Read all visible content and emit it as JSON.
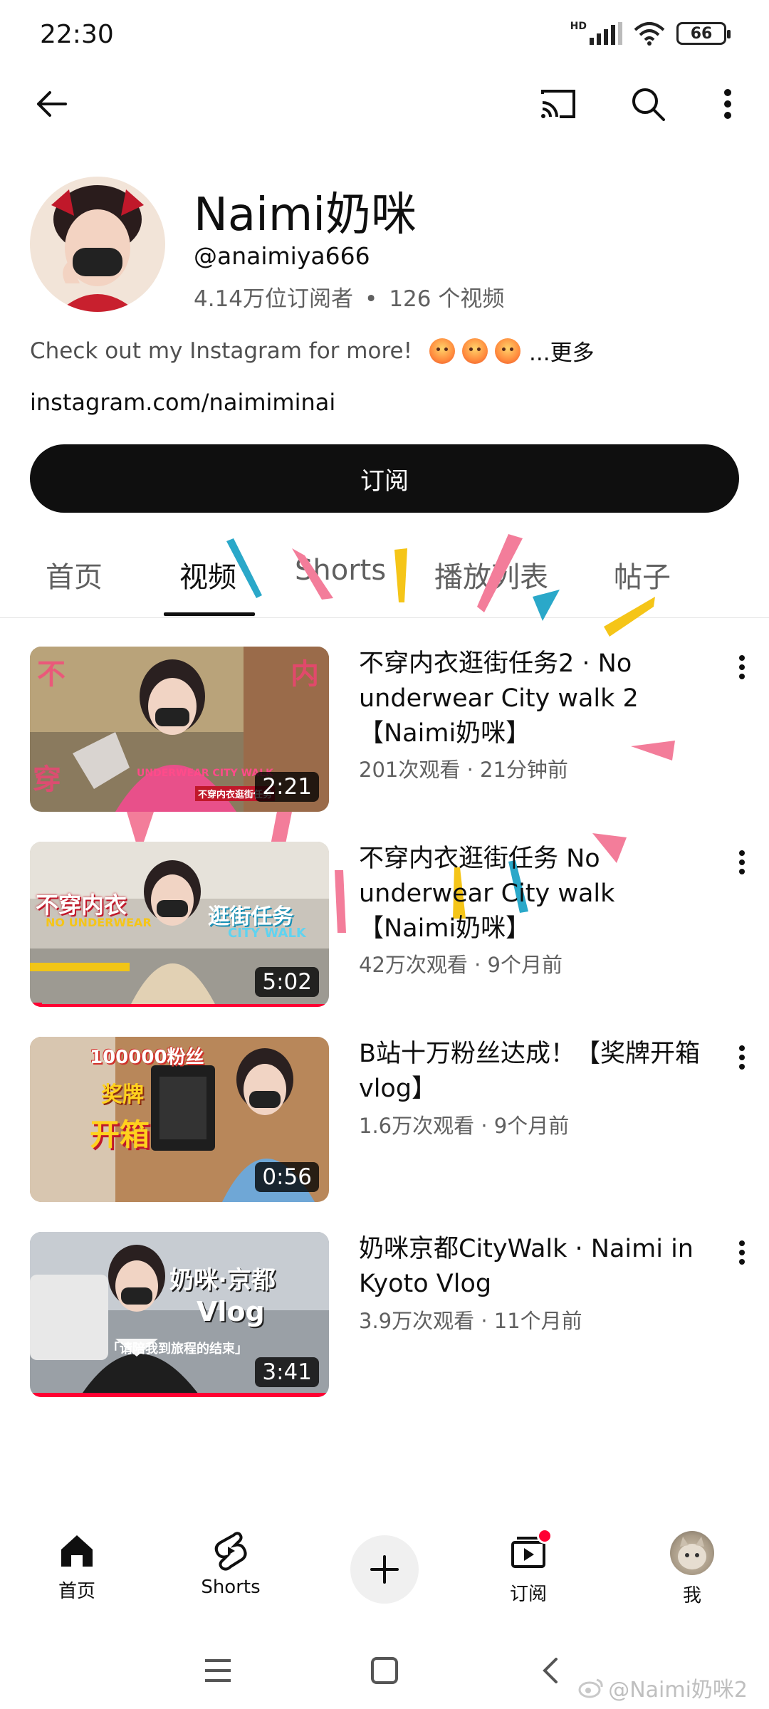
{
  "status_bar": {
    "time": "22:30",
    "battery": "66",
    "network_badge": "HD"
  },
  "top_bar": {
    "icons": [
      "back-arrow-icon",
      "cast-icon",
      "search-icon",
      "more-vert-icon"
    ]
  },
  "channel": {
    "name": "Naimi奶咪",
    "handle": "@anaimiya666",
    "subscribers": "4.14万位订阅者",
    "stats_sep": "•",
    "video_count": "126 个视频",
    "description": "Check out my Instagram for more!",
    "more_label": "...更多",
    "link": "instagram.com/naimiminai",
    "subscribe_label": "订阅"
  },
  "tabs": [
    {
      "label": "首页",
      "active": false
    },
    {
      "label": "视频",
      "active": true
    },
    {
      "label": "Shorts",
      "active": false
    },
    {
      "label": "播放列表",
      "active": false
    },
    {
      "label": "帖子",
      "active": false
    }
  ],
  "videos": [
    {
      "title": "不穿内衣逛街任务2 · No underwear City walk 2 【Naimi奶咪】",
      "meta": "201次观看 · 21分钟前",
      "duration": "2:21",
      "thumb_text": "UNDERWEAR CITY WALK",
      "thumb_sub": "不穿内衣逛街任务",
      "progress": 0
    },
    {
      "title": "不穿内衣逛街任务 No underwear City walk 【Naimi奶咪】",
      "meta": "42万次观看 · 9个月前",
      "duration": "5:02",
      "thumb_text": "不穿内衣",
      "thumb_text_en": "NO UNDERWEAR",
      "thumb_text2": "逛街任务",
      "thumb_text2_en": "CITY WALK",
      "progress": 0.04
    },
    {
      "title": "B站十万粉丝达成！【奖牌开箱vlog】",
      "meta": "1.6万次观看 · 9个月前",
      "duration": "0:56",
      "thumb_text": "100000粉丝",
      "thumb_text2": "奖牌",
      "thumb_text3": "开箱",
      "progress": 0
    },
    {
      "title": "奶咪京都CityWalk · Naimi in Kyoto Vlog",
      "meta": "3.9万次观看 · 11个月前",
      "duration": "3:41",
      "thumb_text": "奶咪·京都",
      "thumb_text2": "Vlog",
      "thumb_sub": "「请陪我到旅程的结束」",
      "progress": 1.0
    }
  ],
  "bottom_nav": [
    {
      "label": "首页",
      "icon": "home-icon"
    },
    {
      "label": "Shorts",
      "icon": "shorts-icon"
    },
    {
      "label": "",
      "icon": "create-plus-icon"
    },
    {
      "label": "订阅",
      "icon": "subscriptions-icon"
    },
    {
      "label": "我",
      "icon": "profile-avatar"
    }
  ],
  "watermark": "@Naimi奶咪2",
  "colors": {
    "accent_red": "#ff0033",
    "text_primary": "#0f0f0f",
    "text_secondary": "#606060",
    "subscribe_bg": "#0f0f0f"
  }
}
